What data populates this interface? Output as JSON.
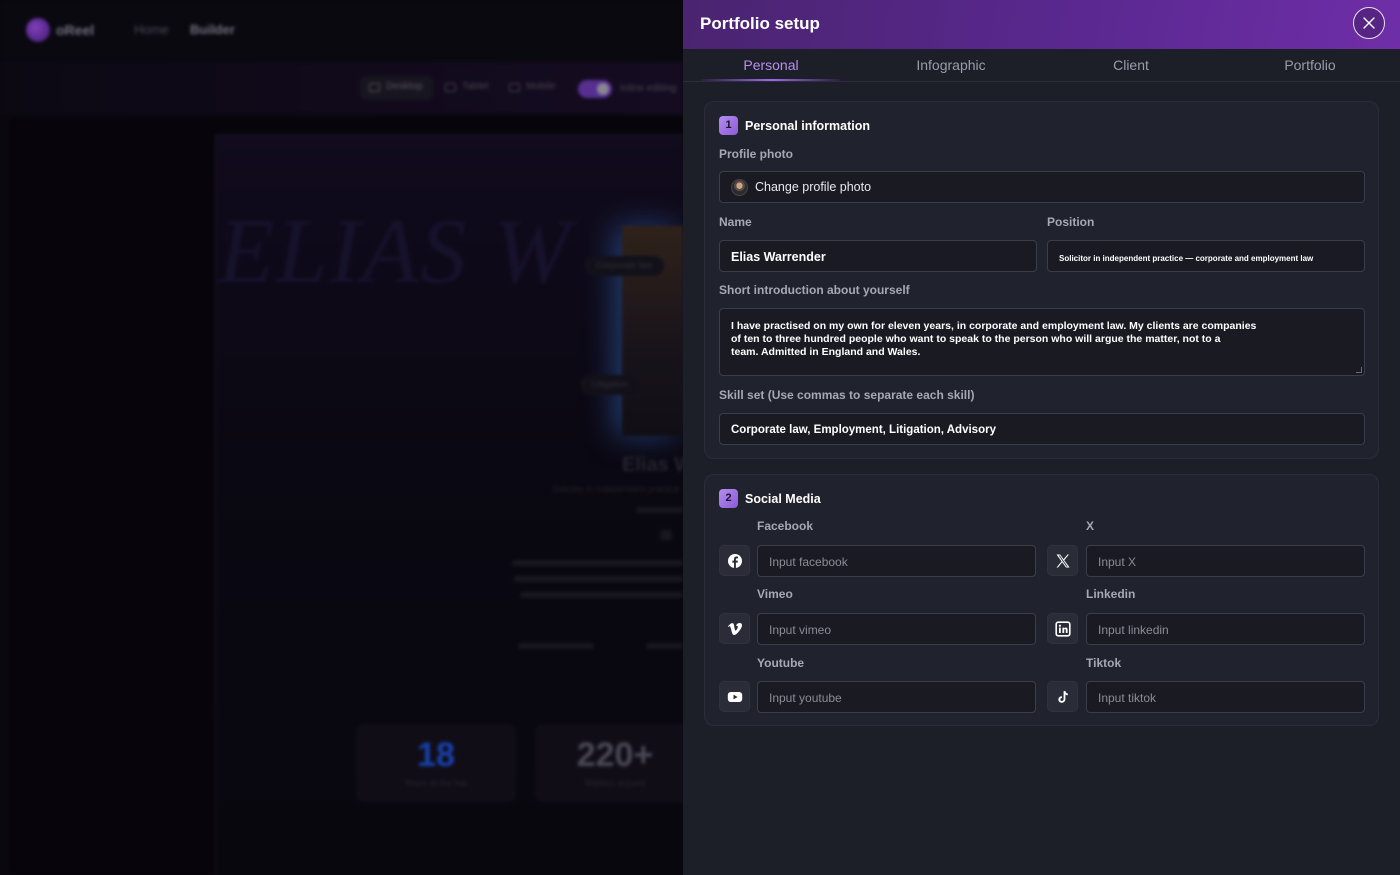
{
  "background_app": {
    "logo_text": "oReel",
    "nav": [
      "Home",
      "Builder"
    ],
    "toolbar": {
      "views": [
        "Desktop",
        "Tablet",
        "Mobile"
      ],
      "inline_editing_label": "Inline editing"
    },
    "hero_name": "ELIAS W",
    "chips": [
      "Corporate law",
      "Litigation"
    ],
    "profile_name": "Elias W",
    "profile_subtitle": "Solicitor in independent practice",
    "stats": [
      {
        "value": "18",
        "label": "Years at the bar",
        "color": "#1e4fd0"
      },
      {
        "value": "220+",
        "label": "Matters argued",
        "color": "#5a5866"
      }
    ]
  },
  "panel": {
    "title": "Portfolio setup",
    "tabs": [
      {
        "label": "Personal",
        "active": true
      },
      {
        "label": "Infographic",
        "active": false
      },
      {
        "label": "Client",
        "active": false
      },
      {
        "label": "Portfolio",
        "active": false
      }
    ],
    "personal": {
      "number": "1",
      "title": "Personal information",
      "profile_photo_label": "Profile photo",
      "change_photo_button": "Change profile photo",
      "name_label": "Name",
      "name_value": "Elias Warrender",
      "position_label": "Position",
      "position_value": "Solicitor in independent practice — corporate and employment law",
      "intro_label": "Short introduction about yourself",
      "intro_lines": [
        "I have practised on my own for eleven years, in corporate and employment law. My clients are companies",
        "of ten to three hundred people who want to speak to the person who will argue the matter, not to a",
        "team. Admitted in England and Wales."
      ],
      "skills_label": "Skill set (Use commas to separate each skill)",
      "skills_value": "Corporate law, Employment, Litigation, Advisory"
    },
    "social": {
      "number": "2",
      "title": "Social Media",
      "items": [
        {
          "label": "Facebook",
          "placeholder": "Input facebook",
          "icon": "facebook-icon"
        },
        {
          "label": "X",
          "placeholder": "Input X",
          "icon": "x-icon"
        },
        {
          "label": "Vimeo",
          "placeholder": "Input vimeo",
          "icon": "vimeo-icon"
        },
        {
          "label": "Linkedin",
          "placeholder": "Input linkedin",
          "icon": "linkedin-icon"
        },
        {
          "label": "Youtube",
          "placeholder": "Input youtube",
          "icon": "youtube-icon"
        },
        {
          "label": "Tiktok",
          "placeholder": "Input tiktok",
          "icon": "tiktok-icon"
        }
      ]
    }
  },
  "colors": {
    "accent": "#b98ef0",
    "header_gradient_start": "#4a2470",
    "header_gradient_end": "#6f2ea8",
    "panel_bg": "#1c1f28"
  }
}
